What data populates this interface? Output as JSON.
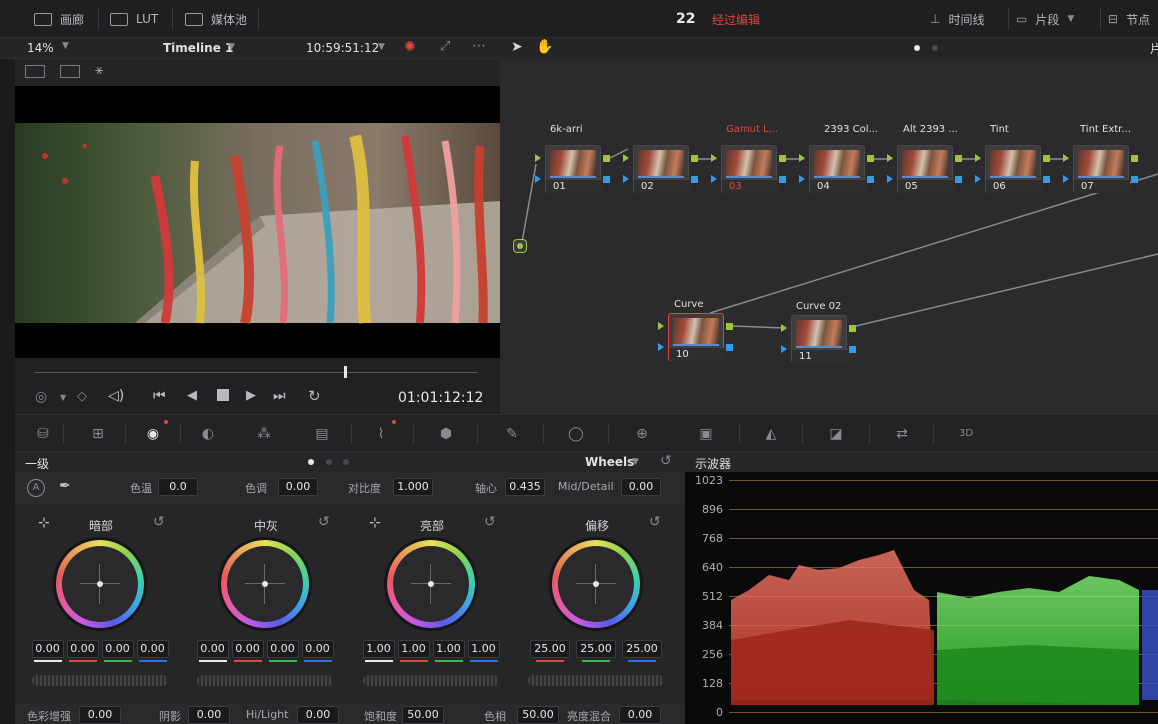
{
  "topbar": {
    "gallery": "画廊",
    "lut": "LUT",
    "media_pool": "媒体池",
    "clip_count": "22",
    "status": "经过编辑",
    "timeline": "时间线",
    "clips": "片段",
    "nodes": "节点"
  },
  "viewer": {
    "zoom": "14%",
    "timeline_name": "Timeline 1",
    "source_tc": "10:59:51:12",
    "record_tc": "01:01:12:12",
    "scrub_position": 0.7
  },
  "nodes": [
    {
      "label": "6k-arri",
      "num": "01",
      "label_color": "#e0e0e0"
    },
    {
      "label": "",
      "num": "02",
      "label_color": "#e0e0e0"
    },
    {
      "label": "Gamut L...",
      "num": "03",
      "label_color": "#e0463c"
    },
    {
      "label": "2393 Col...",
      "num": "04",
      "label_color": "#e0e0e0"
    },
    {
      "label": "Alt 2393 ...",
      "num": "05",
      "label_color": "#e0e0e0"
    },
    {
      "label": "Tint",
      "num": "06",
      "label_color": "#e0e0e0"
    },
    {
      "label": "Tint Extr...",
      "num": "07",
      "label_color": "#e0e0e0"
    },
    {
      "label": "Curve",
      "num": "10",
      "label_color": "#e0e0e0"
    },
    {
      "label": "Curve 02",
      "num": "11",
      "label_color": "#e0e0e0"
    }
  ],
  "primary": {
    "title": "一级",
    "mode": "Wheels",
    "params_top": [
      {
        "label": "色温",
        "value": "0.0"
      },
      {
        "label": "色调",
        "value": "0.00"
      },
      {
        "label": "对比度",
        "value": "1.000"
      },
      {
        "label": "轴心",
        "value": "0.435"
      },
      {
        "label": "Mid/Detail",
        "value": "0.00"
      }
    ],
    "wheels": [
      {
        "title": "暗部",
        "values": [
          "0.00",
          "0.00",
          "0.00",
          "0.00"
        ]
      },
      {
        "title": "中灰",
        "values": [
          "0.00",
          "0.00",
          "0.00",
          "0.00"
        ]
      },
      {
        "title": "亮部",
        "values": [
          "1.00",
          "1.00",
          "1.00",
          "1.00"
        ]
      },
      {
        "title": "偏移",
        "values": [
          "25.00",
          "25.00",
          "25.00"
        ]
      }
    ],
    "params_bottom": [
      {
        "label": "色彩增强",
        "value": "0.00"
      },
      {
        "label": "阴影",
        "value": "0.00"
      },
      {
        "label": "Hi/Light",
        "value": "0.00"
      },
      {
        "label": "饱和度",
        "value": "50.00"
      },
      {
        "label": "色相",
        "value": "50.00"
      },
      {
        "label": "亮度混合",
        "value": "0.00"
      }
    ]
  },
  "scope": {
    "title": "示波器",
    "levels": [
      "1023",
      "896",
      "768",
      "640",
      "512",
      "384",
      "256",
      "128",
      "0"
    ]
  },
  "colors": {
    "accent_green": "#9bc63a",
    "accent_blue": "#2f9de8",
    "accent_red": "#e0463c"
  }
}
